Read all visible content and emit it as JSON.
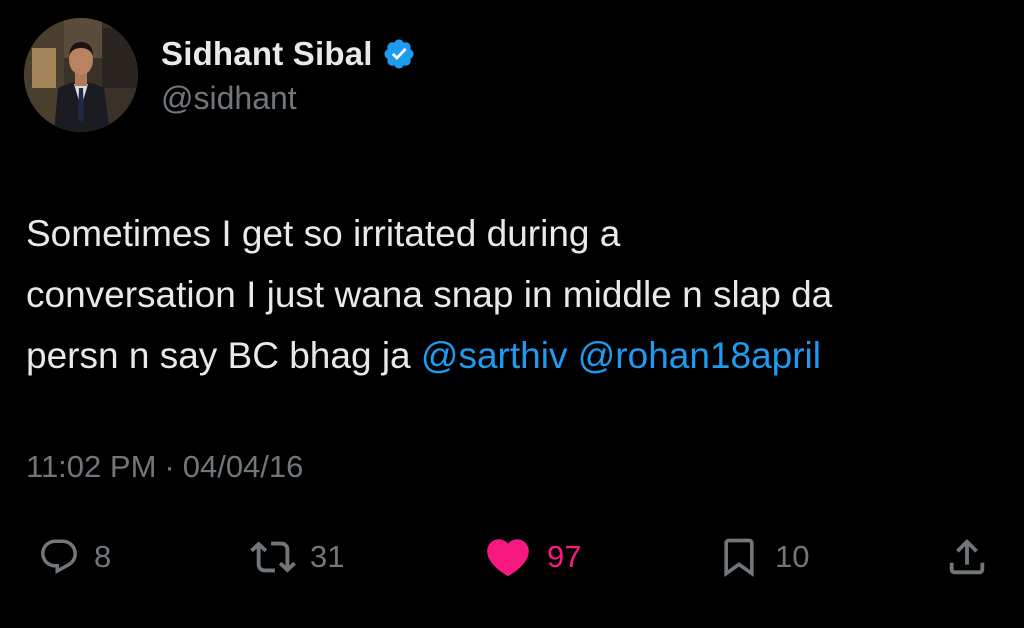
{
  "author": {
    "display_name": "Sidhant Sibal",
    "handle": "@sidhant",
    "verified": true,
    "verified_color": "#1d9bf0"
  },
  "tweet": {
    "lines": [
      {
        "text": "Sometimes I get so irritated during a"
      },
      {
        "text": "conversation I just wana snap in middle n slap da"
      },
      {
        "text": "persn n say BC bhag ja ",
        "mentions": [
          "@sarthiv",
          "@rohan18april"
        ]
      }
    ],
    "mention_color": "#1d9bf0"
  },
  "meta": {
    "time": "11:02 PM",
    "separator": "·",
    "date": "04/04/16"
  },
  "actions": {
    "replies": {
      "icon": "reply-icon",
      "count": "8"
    },
    "retweets": {
      "icon": "retweet-icon",
      "count": "31"
    },
    "likes": {
      "icon": "heart-icon",
      "count": "97",
      "liked": true,
      "color": "#f91880"
    },
    "bookmarks": {
      "icon": "bookmark-icon",
      "count": "10"
    },
    "share": {
      "icon": "share-icon"
    }
  },
  "colors": {
    "background": "#000000",
    "text": "#e7e9ea",
    "secondary": "#71767b"
  }
}
